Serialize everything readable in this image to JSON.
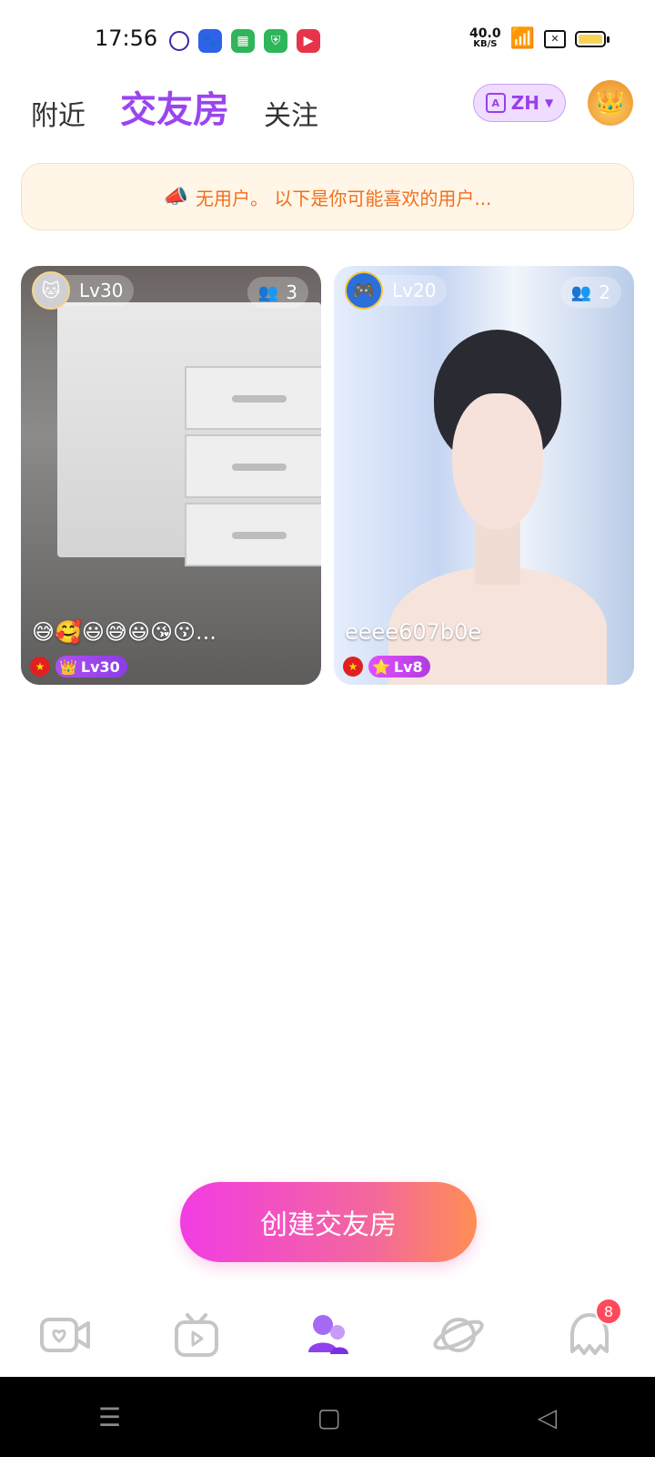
{
  "status": {
    "time": "17:56",
    "net_speed": "40.0",
    "net_unit": "KB/S"
  },
  "tabs": [
    {
      "label": "附近"
    },
    {
      "label": "交友房"
    },
    {
      "label": "关注"
    }
  ],
  "lang_button": {
    "label": "ZH"
  },
  "notice": {
    "text": "无用户。 以下是你可能喜欢的用户..."
  },
  "rooms": [
    {
      "level": "Lv30",
      "count": "3",
      "title": "😅🥰😃😅😃😘😗...",
      "badge_level": "Lv30"
    },
    {
      "level": "Lv20",
      "count": "2",
      "title": "eeee607b0e",
      "badge_level": "Lv8"
    }
  ],
  "create_button": {
    "label": "创建交友房"
  },
  "bottom_nav": {
    "messages_badge": "8"
  },
  "colors": {
    "accent": "#9a45f0",
    "notice_text": "#f26f1c",
    "badge": "#ff4a5c"
  }
}
